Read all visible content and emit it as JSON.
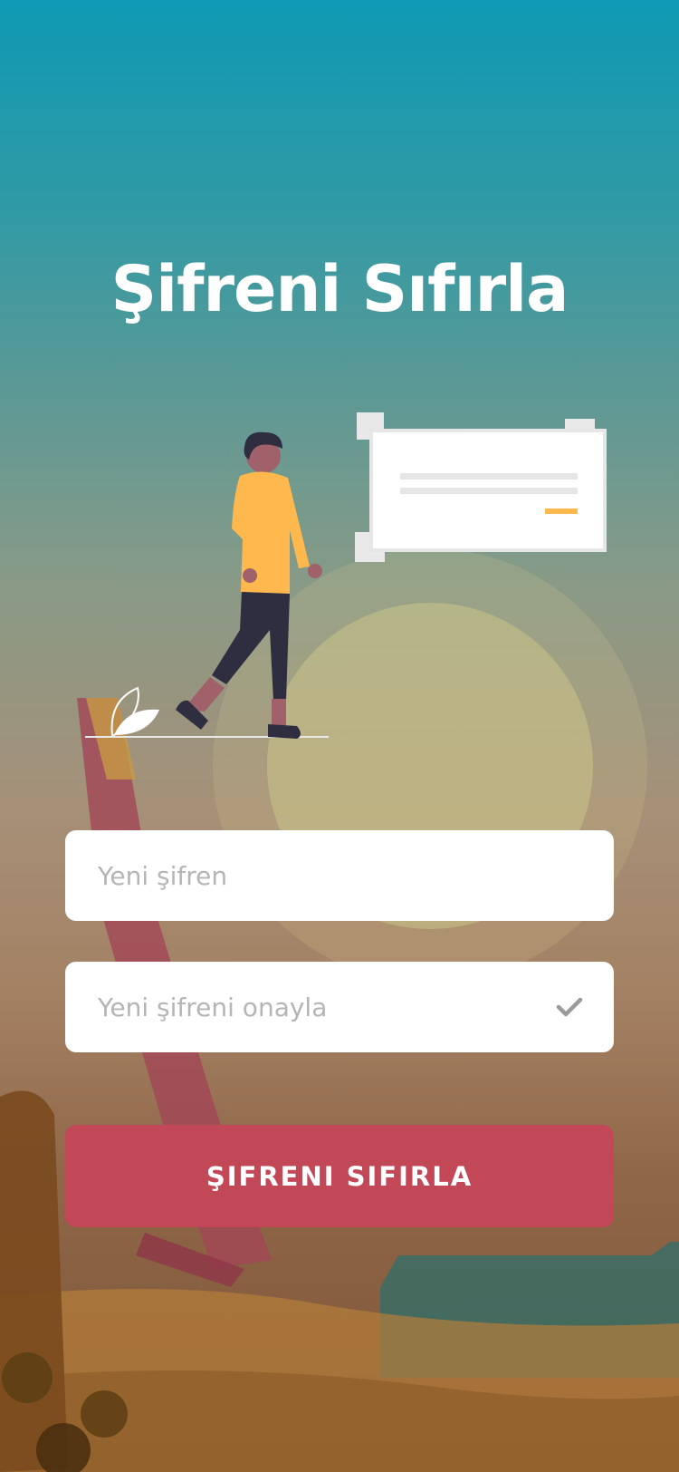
{
  "screen": {
    "title": "Şifreni Sıfırla"
  },
  "form": {
    "new_password": {
      "placeholder": "Yeni şifren",
      "value": ""
    },
    "confirm_password": {
      "placeholder": "Yeni şifreni onayla",
      "value": ""
    },
    "submit_label": "ŞIFRENI SIFIRLA"
  },
  "icons": {
    "confirm_status": "check-icon"
  },
  "colors": {
    "accent": "#c24858",
    "illustration_accent": "#ffb84d",
    "field_background": "#ffffff"
  }
}
